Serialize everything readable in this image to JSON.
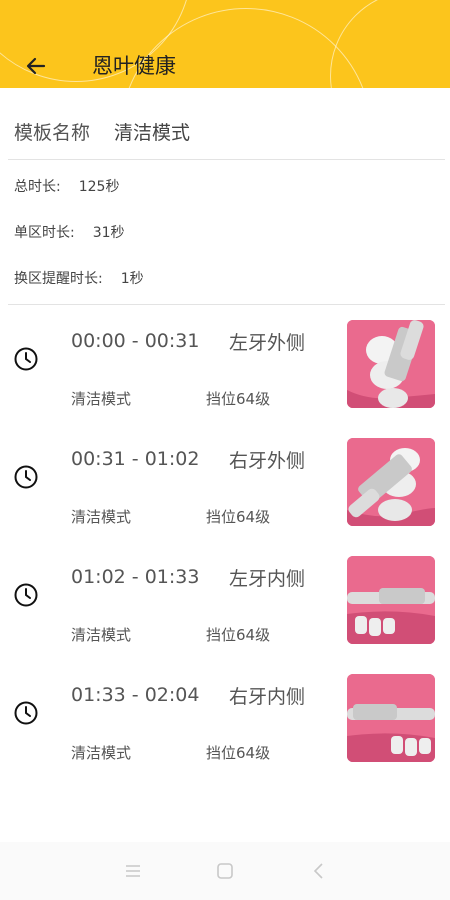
{
  "header": {
    "title": "恩叶健康"
  },
  "template": {
    "name_label": "模板名称",
    "name_value": "清洁模式"
  },
  "info": [
    {
      "label": "总时长:",
      "value": "125秒"
    },
    {
      "label": "单区时长:",
      "value": "31秒"
    },
    {
      "label": "换区提醒时长:",
      "value": "1秒"
    }
  ],
  "steps": [
    {
      "time": "00:00 - 00:31",
      "zone": "左牙外侧",
      "mode": "清洁模式",
      "level": "挡位64级"
    },
    {
      "time": "00:31 - 01:02",
      "zone": "右牙外侧",
      "mode": "清洁模式",
      "level": "挡位64级"
    },
    {
      "time": "01:02 - 01:33",
      "zone": "左牙内侧",
      "mode": "清洁模式",
      "level": "挡位64级"
    },
    {
      "time": "01:33 - 02:04",
      "zone": "右牙内侧",
      "mode": "清洁模式",
      "level": "挡位64级"
    }
  ],
  "icons": {
    "back": "arrow-left-icon",
    "step": "clock-icon",
    "nav": [
      "menu-icon",
      "home-square-icon",
      "back-chevron-icon"
    ]
  },
  "colors": {
    "header": "#fcc51c",
    "thumb": "#e85f86"
  }
}
